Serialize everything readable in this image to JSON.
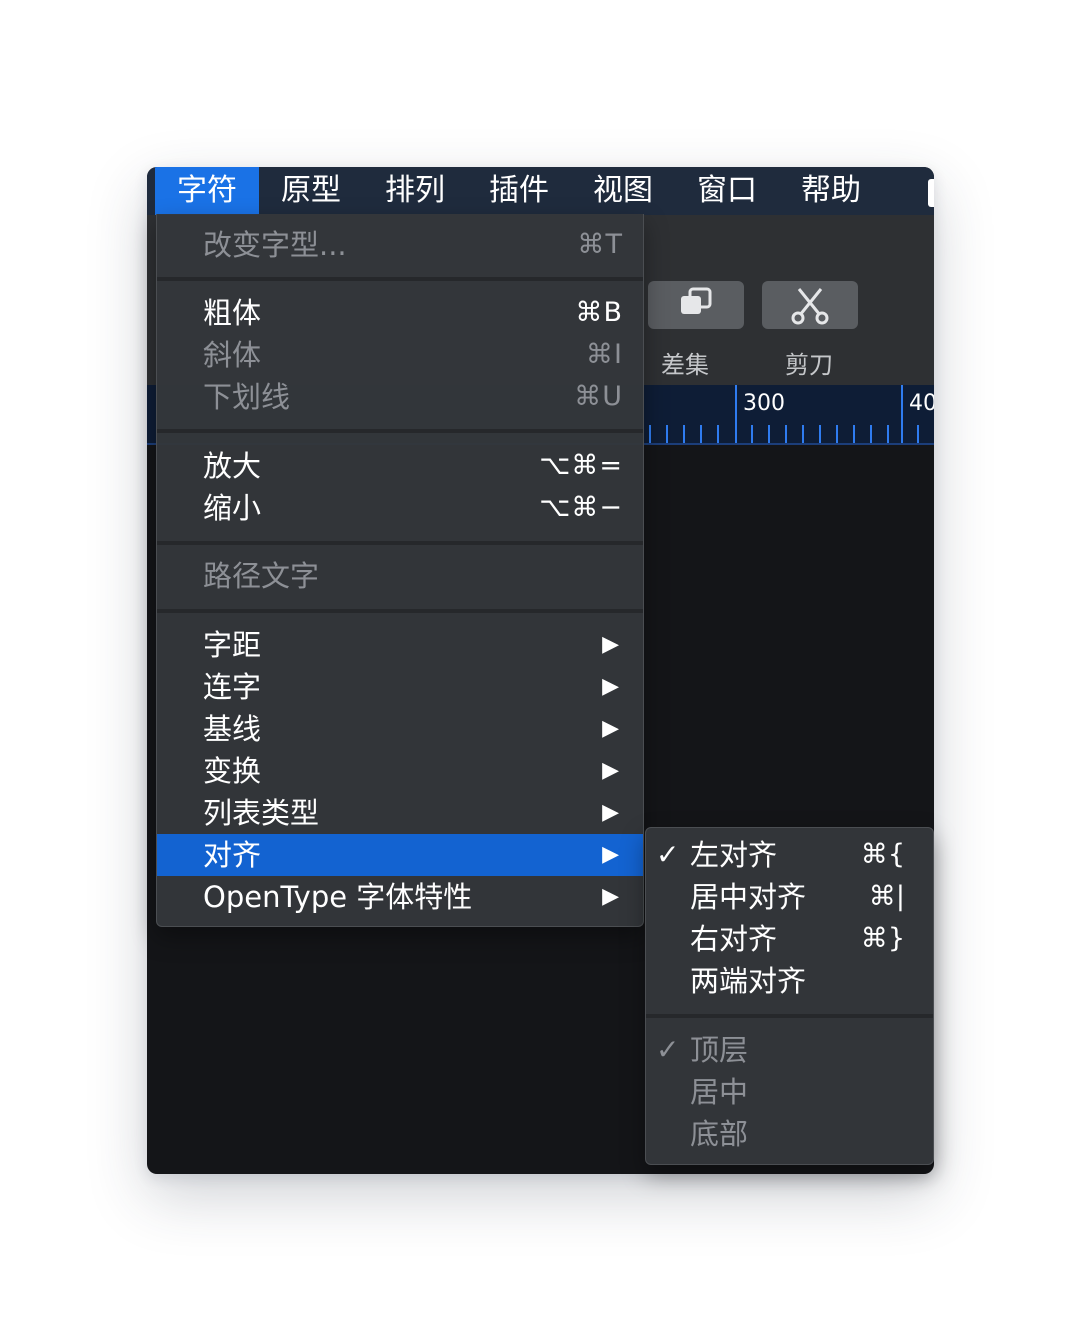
{
  "menubar": {
    "items": [
      {
        "label": "字符",
        "active": true
      },
      {
        "label": "原型"
      },
      {
        "label": "排列"
      },
      {
        "label": "插件"
      },
      {
        "label": "视图"
      },
      {
        "label": "窗口"
      },
      {
        "label": "帮助"
      }
    ]
  },
  "toolbar": {
    "difference_label": "差集",
    "scissors_label": "剪刀"
  },
  "ruler": {
    "mark_300": "300",
    "mark_400": "40"
  },
  "menu": {
    "change_font": {
      "label": "改变字型...",
      "shortcut": "⌘T",
      "enabled": false
    },
    "bold": {
      "label": "粗体",
      "shortcut": "⌘B",
      "enabled": true
    },
    "italic": {
      "label": "斜体",
      "shortcut": "⌘I",
      "enabled": false
    },
    "underline": {
      "label": "下划线",
      "shortcut": "⌘U",
      "enabled": false
    },
    "bigger": {
      "label": "放大",
      "shortcut": "⌥⌘=",
      "enabled": true
    },
    "smaller": {
      "label": "缩小",
      "shortcut": "⌥⌘−",
      "enabled": true
    },
    "text_on_path": {
      "label": "路径文字",
      "enabled": false
    },
    "kerning": {
      "label": "字距",
      "arrow": "▶"
    },
    "ligature": {
      "label": "连字",
      "arrow": "▶"
    },
    "baseline": {
      "label": "基线",
      "arrow": "▶"
    },
    "transform": {
      "label": "变换",
      "arrow": "▶"
    },
    "list_type": {
      "label": "列表类型",
      "arrow": "▶"
    },
    "alignment": {
      "label": "对齐",
      "arrow": "▶",
      "selected": true
    },
    "opentype": {
      "label": "OpenType 字体特性",
      "arrow": "▶"
    }
  },
  "submenu": {
    "align_left": {
      "label": "左对齐",
      "shortcut": "⌘{",
      "checked": true,
      "check": "✓"
    },
    "align_center": {
      "label": "居中对齐",
      "shortcut": "⌘|"
    },
    "align_right": {
      "label": "右对齐",
      "shortcut": "⌘}"
    },
    "justify": {
      "label": "两端对齐"
    },
    "top": {
      "label": "顶层",
      "checked": true,
      "check": "✓",
      "enabled": false
    },
    "middle": {
      "label": "居中",
      "enabled": false
    },
    "bottom": {
      "label": "底部",
      "enabled": false
    }
  },
  "colors": {
    "accent": "#1a72e6",
    "selected_item": "#1363d1",
    "menu_bg": "#34373b",
    "menubar_bg": "#1f2b3d"
  }
}
